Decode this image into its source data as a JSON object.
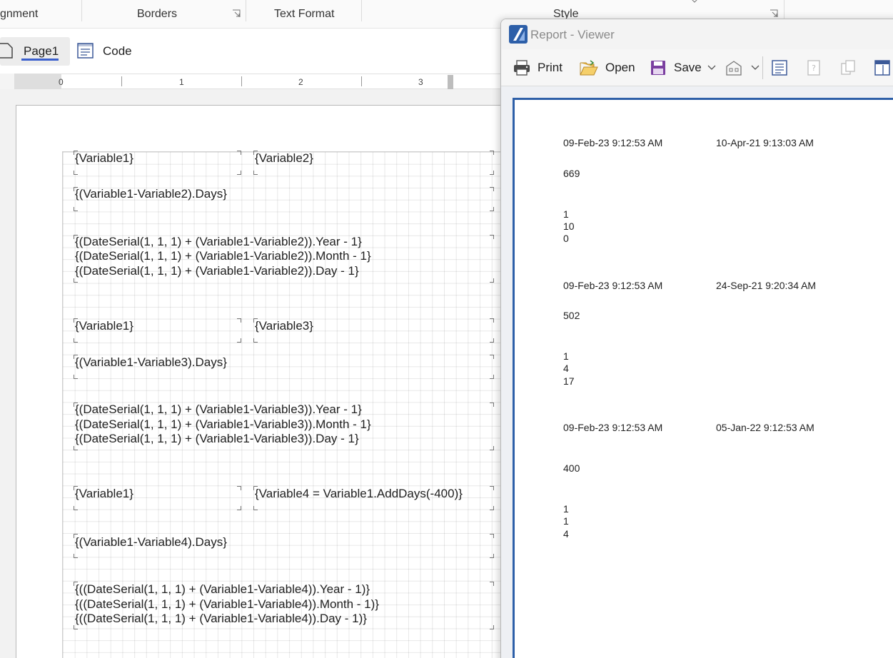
{
  "ribbon": {
    "alignment_label": "gnment",
    "borders_label": "Borders",
    "text_format_label": "Text Format",
    "style_label": "Style"
  },
  "tabs": {
    "page1": "Page1",
    "code": "Code"
  },
  "ruler": {
    "marks": [
      "0",
      "1",
      "2",
      "3"
    ]
  },
  "design": {
    "block1": {
      "var_a": "{Variable1}",
      "var_b": "{Variable2}",
      "days": "{(Variable1-Variable2).Days}",
      "ymd": [
        "{(DateSerial(1, 1, 1) + (Variable1-Variable2)).Year - 1}",
        "{(DateSerial(1, 1, 1) + (Variable1-Variable2)).Month - 1}",
        "{(DateSerial(1, 1, 1) + (Variable1-Variable2)).Day - 1}"
      ]
    },
    "block2": {
      "var_a": "{Variable1}",
      "var_b": "{Variable3}",
      "days": "{(Variable1-Variable3).Days}",
      "ymd": [
        "{(DateSerial(1, 1, 1) + (Variable1-Variable3)).Year - 1}",
        "{(DateSerial(1, 1, 1) + (Variable1-Variable3)).Month - 1}",
        "{(DateSerial(1, 1, 1) + (Variable1-Variable3)).Day - 1}"
      ]
    },
    "block3": {
      "var_a": "{Variable1}",
      "var_b": "{Variable4 = Variable1.AddDays(-400)}",
      "days": "{(Variable1-Variable4).Days}",
      "ymd": [
        "{((DateSerial(1, 1, 1) + (Variable1-Variable4)).Year - 1)}",
        "{((DateSerial(1, 1, 1) + (Variable1-Variable4)).Month - 1)}",
        "{((DateSerial(1, 1, 1) + (Variable1-Variable4)).Day - 1)}"
      ]
    }
  },
  "viewer": {
    "title": "Report - Viewer",
    "toolbar": {
      "print": "Print",
      "open": "Open",
      "save": "Save"
    },
    "results": [
      {
        "date_a": "09-Feb-23 9:12:53 AM",
        "date_b": "10-Apr-21 9:13:03 AM",
        "days": "669",
        "y": "1",
        "m": "10",
        "d": "0"
      },
      {
        "date_a": "09-Feb-23 9:12:53 AM",
        "date_b": "24-Sep-21 9:20:34 AM",
        "days": "502",
        "y": "1",
        "m": "4",
        "d": "17"
      },
      {
        "date_a": "09-Feb-23 9:12:53 AM",
        "date_b": "05-Jan-22 9:12:53 AM",
        "days": "400",
        "y": "1",
        "m": "1",
        "d": "4"
      }
    ]
  },
  "colors": {
    "accent": "#3a5fcd",
    "viewer_border": "#2d5fa8",
    "save_icon": "#7b3fa0"
  }
}
